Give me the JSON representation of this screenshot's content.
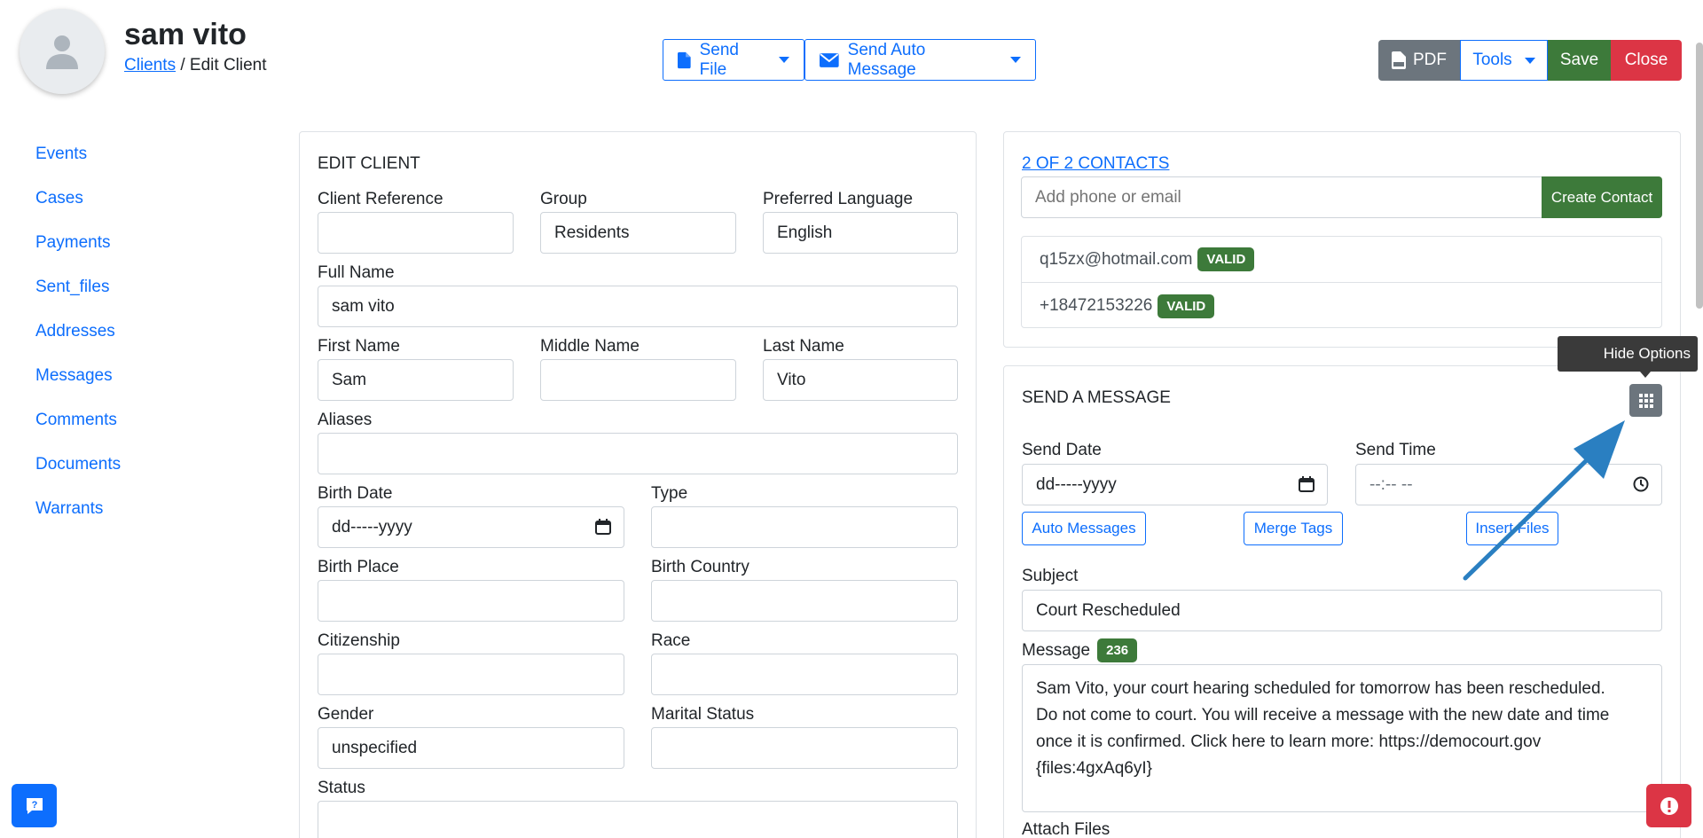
{
  "header": {
    "client_name": "sam vito",
    "breadcrumb_link": "Clients",
    "breadcrumb_sep": "/",
    "breadcrumb_current": "Edit Client",
    "send_file_label": "Send File",
    "send_auto_message_label": "Send Auto Message",
    "pdf_label": "PDF",
    "tools_label": "Tools",
    "save_label": "Save",
    "close_label": "Close"
  },
  "sidebar": {
    "items": [
      {
        "label": "Events"
      },
      {
        "label": "Cases"
      },
      {
        "label": "Payments"
      },
      {
        "label": "Sent_files"
      },
      {
        "label": "Addresses"
      },
      {
        "label": "Messages"
      },
      {
        "label": "Comments"
      },
      {
        "label": "Documents"
      },
      {
        "label": "Warrants"
      }
    ]
  },
  "edit_client": {
    "title": "EDIT CLIENT",
    "client_reference": {
      "label": "Client Reference",
      "value": ""
    },
    "group": {
      "label": "Group",
      "value": "Residents"
    },
    "preferred_language": {
      "label": "Preferred Language",
      "value": "English"
    },
    "full_name": {
      "label": "Full Name",
      "value": "sam vito"
    },
    "first_name": {
      "label": "First Name",
      "value": "Sam"
    },
    "middle_name": {
      "label": "Middle Name",
      "value": ""
    },
    "last_name": {
      "label": "Last Name",
      "value": "Vito"
    },
    "aliases": {
      "label": "Aliases",
      "value": ""
    },
    "birth_date": {
      "label": "Birth Date",
      "value": "dd-----yyyy"
    },
    "type": {
      "label": "Type",
      "value": ""
    },
    "birth_place": {
      "label": "Birth Place",
      "value": ""
    },
    "birth_country": {
      "label": "Birth Country",
      "value": ""
    },
    "citizenship": {
      "label": "Citizenship",
      "value": ""
    },
    "race": {
      "label": "Race",
      "value": ""
    },
    "gender": {
      "label": "Gender",
      "value": "unspecified"
    },
    "marital_status": {
      "label": "Marital Status",
      "value": ""
    },
    "status": {
      "label": "Status",
      "value": ""
    }
  },
  "contacts": {
    "title_link": "2 OF 2 CONTACTS",
    "add_placeholder": "Add phone or email",
    "create_label": "Create Contact",
    "items": [
      {
        "value": "q15zx@hotmail.com",
        "badge": "VALID"
      },
      {
        "value": "+18472153226",
        "badge": "VALID"
      }
    ]
  },
  "send_message": {
    "title": "SEND A MESSAGE",
    "tooltip": "Hide Options",
    "send_date": {
      "label": "Send Date",
      "value": "dd-----yyyy"
    },
    "send_time": {
      "label": "Send Time",
      "value": "--:-- --"
    },
    "auto_messages_label": "Auto Messages",
    "merge_tags_label": "Merge Tags",
    "insert_files_label": "Insert Files",
    "subject": {
      "label": "Subject",
      "value": "Court Rescheduled"
    },
    "message": {
      "label": "Message",
      "count": "236",
      "lines": [
        "Sam Vito, your court hearing scheduled for tomorrow has been rescheduled.",
        "Do not come to court. You will receive a message with the new date and time",
        "once it is confirmed. Click here to learn more: https://democourt.gov",
        "{files:4gxAq6yI}"
      ]
    },
    "attach_files_label": "Attach Files"
  },
  "colors": {
    "primary": "#0d6efd",
    "success": "#3d7a3a",
    "danger": "#dc3545",
    "secondary": "#6c757d",
    "annotation_arrow": "#2a7fc1"
  },
  "icons": {
    "avatar": "person-icon",
    "send_file": "file-icon",
    "send_auto_message": "envelope-icon",
    "pdf": "pdf-file-icon",
    "grid": "grid-icon",
    "calendar": "calendar-icon",
    "clock": "clock-icon",
    "help": "help-chat-icon",
    "alert": "alert-icon"
  }
}
